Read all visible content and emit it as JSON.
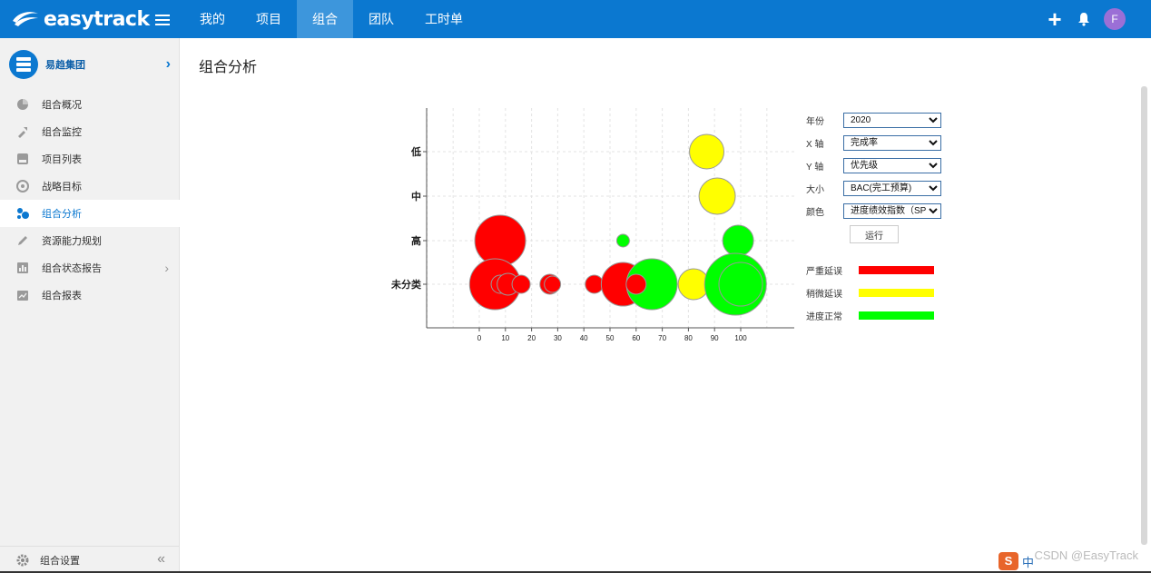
{
  "app": {
    "logo_text": "easytrack"
  },
  "nav": {
    "items": [
      {
        "label": "我的"
      },
      {
        "label": "项目"
      },
      {
        "label": "组合",
        "active": true
      },
      {
        "label": "团队"
      },
      {
        "label": "工时单"
      }
    ]
  },
  "user": {
    "avatar_letter": "F"
  },
  "sidebar": {
    "org_name": "易趋集团",
    "items": [
      {
        "label": "组合概况",
        "icon": "pie-icon"
      },
      {
        "label": "组合监控",
        "icon": "wrench-icon"
      },
      {
        "label": "项目列表",
        "icon": "list-icon"
      },
      {
        "label": "战略目标",
        "icon": "target-icon"
      },
      {
        "label": "组合分析",
        "icon": "bubbles-icon",
        "active": true
      },
      {
        "label": "资源能力规划",
        "icon": "pencil-icon"
      },
      {
        "label": "组合状态报告",
        "icon": "bar-chart-icon",
        "has_submenu": true
      },
      {
        "label": "组合报表",
        "icon": "report-icon"
      }
    ],
    "footer_label": "组合设置"
  },
  "page": {
    "title": "组合分析"
  },
  "controls": {
    "year_label": "年份",
    "year_value": "2020",
    "x_label": "X 轴",
    "x_value": "完成率",
    "y_label": "Y 轴",
    "y_value": "优先级",
    "size_label": "大小",
    "size_value": "BAC(完工预算)",
    "color_label": "颜色",
    "color_value": "进度绩效指数（SPI）",
    "run_label": "运行"
  },
  "legend": [
    {
      "label": "严重延误",
      "color": "#ff0000"
    },
    {
      "label": "稍微延误",
      "color": "#ffff00"
    },
    {
      "label": "进度正常",
      "color": "#00ff00"
    }
  ],
  "chart_data": {
    "type": "scatter",
    "x_ticks": [
      0,
      10,
      20,
      30,
      40,
      50,
      60,
      70,
      80,
      90,
      100
    ],
    "y_categories": [
      "未分类",
      "高",
      "中",
      "低"
    ],
    "xlim": [
      -20,
      110
    ],
    "grid": true,
    "points": [
      {
        "x": 8,
        "y": "高",
        "r": 28,
        "status": "severe"
      },
      {
        "x": 55,
        "y": "高",
        "r": 7,
        "status": "normal"
      },
      {
        "x": 99,
        "y": "高",
        "r": 17,
        "status": "normal"
      },
      {
        "x": 87,
        "y": "低",
        "r": 19,
        "status": "slight"
      },
      {
        "x": 91,
        "y": "中",
        "r": 20,
        "status": "slight"
      },
      {
        "x": 6,
        "y": "未分类",
        "r": 28,
        "status": "severe"
      },
      {
        "x": 8,
        "y": "未分类",
        "r": 10,
        "status": "severe"
      },
      {
        "x": 11,
        "y": "未分类",
        "r": 12,
        "status": "severe"
      },
      {
        "x": 16,
        "y": "未分类",
        "r": 10,
        "status": "severe"
      },
      {
        "x": 27,
        "y": "未分类",
        "r": 11,
        "status": "severe"
      },
      {
        "x": 28,
        "y": "未分类",
        "r": 9,
        "status": "severe"
      },
      {
        "x": 44,
        "y": "未分类",
        "r": 10,
        "status": "severe"
      },
      {
        "x": 55,
        "y": "未分类",
        "r": 24,
        "status": "severe"
      },
      {
        "x": 66,
        "y": "未分类",
        "r": 28,
        "status": "normal"
      },
      {
        "x": 60,
        "y": "未分类",
        "r": 11,
        "status": "severe"
      },
      {
        "x": 82,
        "y": "未分类",
        "r": 17,
        "status": "slight"
      },
      {
        "x": 98,
        "y": "未分类",
        "r": 34,
        "status": "normal"
      },
      {
        "x": 100,
        "y": "未分类",
        "r": 24,
        "status": "normal"
      }
    ],
    "status_colors": {
      "severe": "#ff0000",
      "slight": "#ffff00",
      "normal": "#00ff00"
    }
  },
  "watermark": "CSDN @EasyTrack",
  "tray": {
    "s_icon": "S",
    "ime": "中"
  }
}
